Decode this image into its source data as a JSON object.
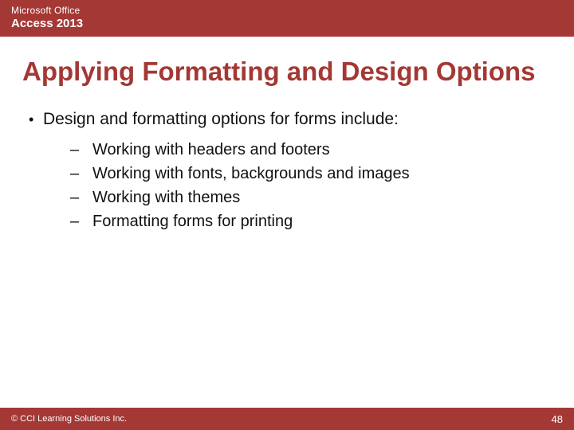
{
  "header": {
    "line1": "Microsoft Office",
    "line2": "Access 2013"
  },
  "title": "Applying Formatting and Design Options",
  "bullets": [
    {
      "text": "Design and formatting options for forms include:",
      "sub": [
        "Working with headers and footers",
        "Working with fonts, backgrounds and images",
        "Working with themes",
        "Formatting forms for printing"
      ]
    }
  ],
  "footer": {
    "copyright": "© CCI Learning Solutions Inc.",
    "page": "48"
  }
}
